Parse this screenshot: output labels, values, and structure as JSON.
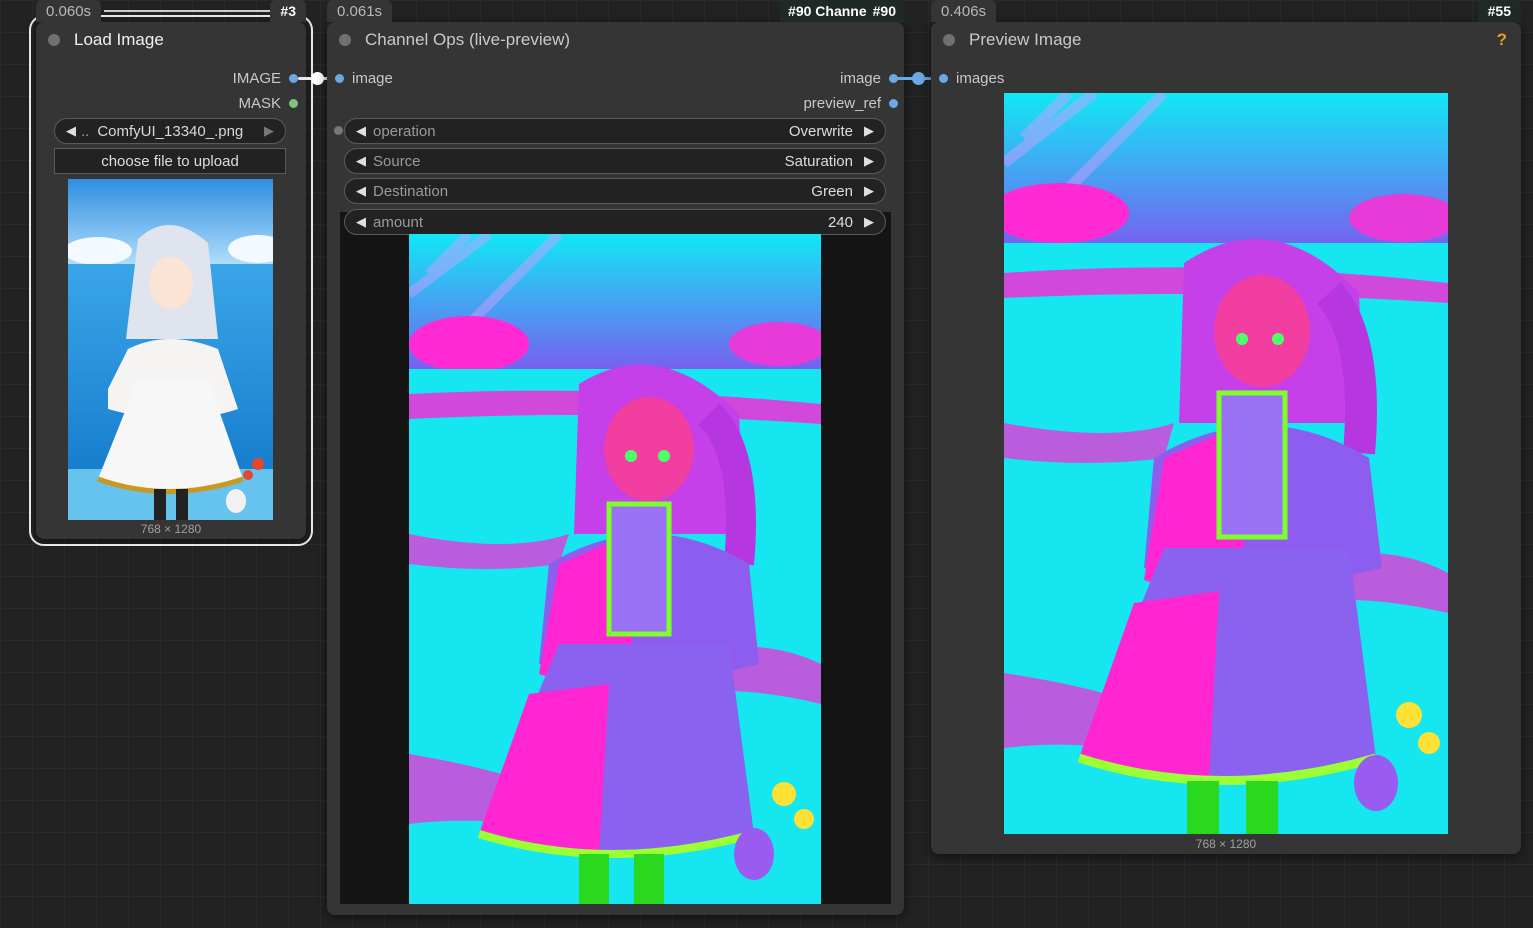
{
  "nodes": {
    "load_image": {
      "time": "0.060s",
      "id": "#3",
      "title": "Load Image",
      "outputs": [
        "IMAGE",
        "MASK"
      ],
      "file_widget": {
        "prefix": "..",
        "value": "ComfyUI_13340_.png"
      },
      "upload_label": "choose file to upload",
      "image_size": "768 × 1280"
    },
    "channel_ops": {
      "time": "0.061s",
      "id": "#90",
      "id_label": "#90 Channe",
      "title": "Channel Ops (live-preview)",
      "input": "image",
      "outputs": [
        "image",
        "preview_ref"
      ],
      "widgets": [
        {
          "label": "operation",
          "value": "Overwrite"
        },
        {
          "label": "Source",
          "value": "Saturation"
        },
        {
          "label": "Destination",
          "value": "Green"
        },
        {
          "label": "amount",
          "value": "240"
        }
      ]
    },
    "preview_image": {
      "time": "0.406s",
      "id": "#55",
      "title": "Preview Image",
      "input": "images",
      "help_glyph": "?",
      "image_size": "768 × 1280"
    }
  },
  "colors": {
    "image_slot": "#6aa9e6",
    "mask_slot": "#7fc27f",
    "node_bg": "#353535",
    "canvas_bg": "#222222",
    "help": "#e8a020"
  },
  "icons": {
    "arrow_left": "◀",
    "arrow_right": "▶"
  }
}
